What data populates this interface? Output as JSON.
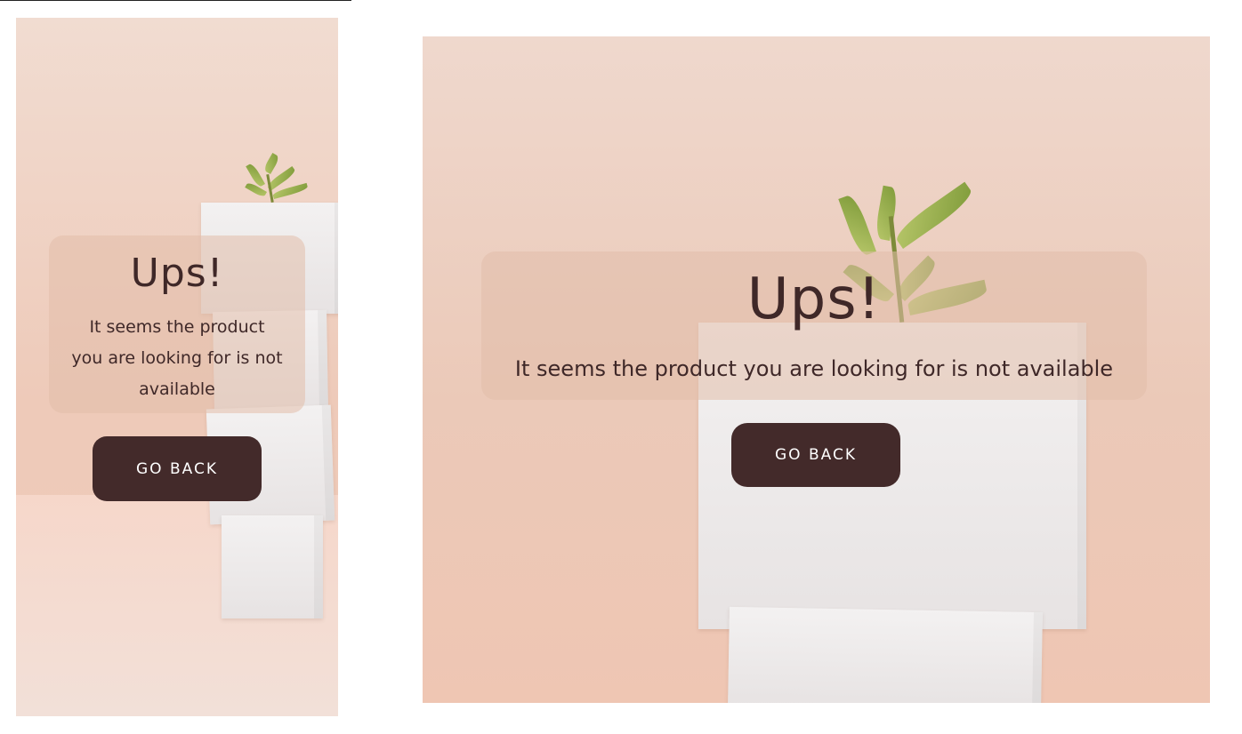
{
  "mobile": {
    "title": "Ups!",
    "message": "It seems the product you are looking for is not available",
    "button_label": "GO BACK"
  },
  "desktop": {
    "title": "Ups!",
    "message": "It seems the product you are looking for is not available",
    "button_label": "GO BACK"
  },
  "colors": {
    "accent": "#432a2a",
    "text": "#3f2828",
    "background": "#eecab9"
  },
  "icons": {
    "illustration": "plant-on-cubes"
  }
}
